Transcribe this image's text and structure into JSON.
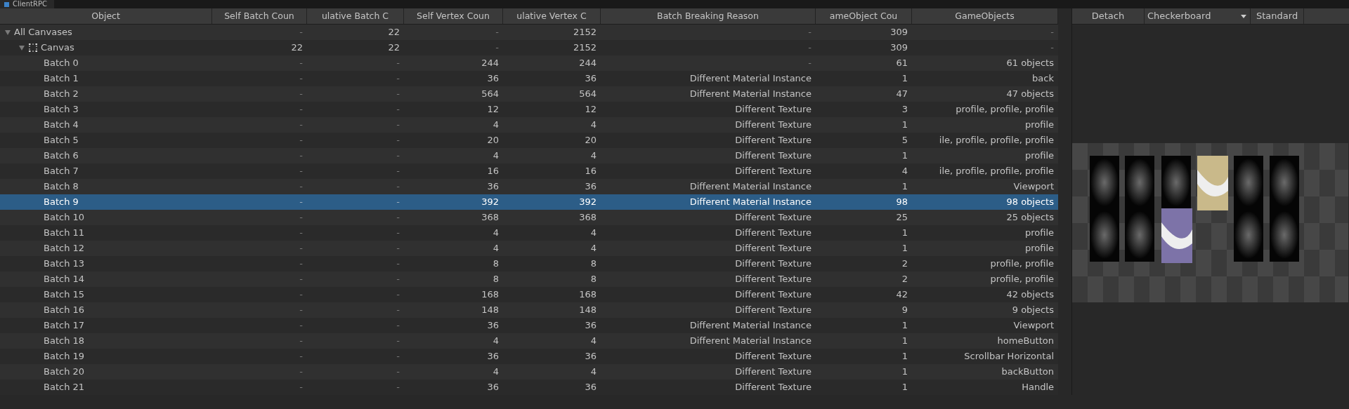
{
  "tab": {
    "label": "ClientRPC"
  },
  "table": {
    "columns": [
      "Object",
      "Self Batch Coun",
      "ulative Batch C",
      "Self Vertex Coun",
      "ulative Vertex C",
      "Batch Breaking Reason",
      "ameObject Cou",
      "GameObjects"
    ],
    "rows": [
      {
        "label": "All Canvases",
        "kind": "root",
        "expanded": true,
        "selected": false,
        "cells": [
          "-",
          "22",
          "-",
          "2152",
          "-",
          "309",
          "-"
        ],
        "children": [
          {
            "label": "Canvas",
            "kind": "canvas",
            "expanded": true,
            "selected": false,
            "cells": [
              "22",
              "22",
              "-",
              "2152",
              "-",
              "309",
              "-"
            ],
            "children": [
              {
                "label": "Batch 0",
                "kind": "batch",
                "selected": false,
                "cells": [
                  "-",
                  "-",
                  "244",
                  "244",
                  "-",
                  "61",
                  "61 objects"
                ]
              },
              {
                "label": "Batch 1",
                "kind": "batch",
                "selected": false,
                "cells": [
                  "-",
                  "-",
                  "36",
                  "36",
                  "Different Material Instance",
                  "1",
                  "back"
                ]
              },
              {
                "label": "Batch 2",
                "kind": "batch",
                "selected": false,
                "cells": [
                  "-",
                  "-",
                  "564",
                  "564",
                  "Different Material Instance",
                  "47",
                  "47 objects"
                ]
              },
              {
                "label": "Batch 3",
                "kind": "batch",
                "selected": false,
                "cells": [
                  "-",
                  "-",
                  "12",
                  "12",
                  "Different Texture",
                  "3",
                  "profile, profile, profile"
                ]
              },
              {
                "label": "Batch 4",
                "kind": "batch",
                "selected": false,
                "cells": [
                  "-",
                  "-",
                  "4",
                  "4",
                  "Different Texture",
                  "1",
                  "profile"
                ]
              },
              {
                "label": "Batch 5",
                "kind": "batch",
                "selected": false,
                "cells": [
                  "-",
                  "-",
                  "20",
                  "20",
                  "Different Texture",
                  "5",
                  "ile, profile, profile, profile"
                ]
              },
              {
                "label": "Batch 6",
                "kind": "batch",
                "selected": false,
                "cells": [
                  "-",
                  "-",
                  "4",
                  "4",
                  "Different Texture",
                  "1",
                  "profile"
                ]
              },
              {
                "label": "Batch 7",
                "kind": "batch",
                "selected": false,
                "cells": [
                  "-",
                  "-",
                  "16",
                  "16",
                  "Different Texture",
                  "4",
                  "ile, profile, profile, profile"
                ]
              },
              {
                "label": "Batch 8",
                "kind": "batch",
                "selected": false,
                "cells": [
                  "-",
                  "-",
                  "36",
                  "36",
                  "Different Material Instance",
                  "1",
                  "Viewport"
                ]
              },
              {
                "label": "Batch 9",
                "kind": "batch",
                "selected": true,
                "cells": [
                  "-",
                  "-",
                  "392",
                  "392",
                  "Different Material Instance",
                  "98",
                  "98 objects"
                ]
              },
              {
                "label": "Batch 10",
                "kind": "batch",
                "selected": false,
                "cells": [
                  "-",
                  "-",
                  "368",
                  "368",
                  "Different Texture",
                  "25",
                  "25 objects"
                ]
              },
              {
                "label": "Batch 11",
                "kind": "batch",
                "selected": false,
                "cells": [
                  "-",
                  "-",
                  "4",
                  "4",
                  "Different Texture",
                  "1",
                  "profile"
                ]
              },
              {
                "label": "Batch 12",
                "kind": "batch",
                "selected": false,
                "cells": [
                  "-",
                  "-",
                  "4",
                  "4",
                  "Different Texture",
                  "1",
                  "profile"
                ]
              },
              {
                "label": "Batch 13",
                "kind": "batch",
                "selected": false,
                "cells": [
                  "-",
                  "-",
                  "8",
                  "8",
                  "Different Texture",
                  "2",
                  "profile, profile"
                ]
              },
              {
                "label": "Batch 14",
                "kind": "batch",
                "selected": false,
                "cells": [
                  "-",
                  "-",
                  "8",
                  "8",
                  "Different Texture",
                  "2",
                  "profile, profile"
                ]
              },
              {
                "label": "Batch 15",
                "kind": "batch",
                "selected": false,
                "cells": [
                  "-",
                  "-",
                  "168",
                  "168",
                  "Different Texture",
                  "42",
                  "42 objects"
                ]
              },
              {
                "label": "Batch 16",
                "kind": "batch",
                "selected": false,
                "cells": [
                  "-",
                  "-",
                  "148",
                  "148",
                  "Different Texture",
                  "9",
                  "9 objects"
                ]
              },
              {
                "label": "Batch 17",
                "kind": "batch",
                "selected": false,
                "cells": [
                  "-",
                  "-",
                  "36",
                  "36",
                  "Different Material Instance",
                  "1",
                  "Viewport"
                ]
              },
              {
                "label": "Batch 18",
                "kind": "batch",
                "selected": false,
                "cells": [
                  "-",
                  "-",
                  "4",
                  "4",
                  "Different Material Instance",
                  "1",
                  "homeButton"
                ]
              },
              {
                "label": "Batch 19",
                "kind": "batch",
                "selected": false,
                "cells": [
                  "-",
                  "-",
                  "36",
                  "36",
                  "Different Texture",
                  "1",
                  "Scrollbar Horizontal"
                ]
              },
              {
                "label": "Batch 20",
                "kind": "batch",
                "selected": false,
                "cells": [
                  "-",
                  "-",
                  "4",
                  "4",
                  "Different Texture",
                  "1",
                  "backButton"
                ]
              },
              {
                "label": "Batch 21",
                "kind": "batch",
                "selected": false,
                "cells": [
                  "-",
                  "-",
                  "36",
                  "36",
                  "Different Texture",
                  "1",
                  "Handle"
                ]
              }
            ]
          }
        ]
      }
    ]
  },
  "preview": {
    "toolbar": [
      {
        "label": "Detach",
        "kind": "button"
      },
      {
        "label": "Checkerboard",
        "kind": "dropdown"
      },
      {
        "label": "Standard",
        "kind": "button"
      }
    ]
  }
}
